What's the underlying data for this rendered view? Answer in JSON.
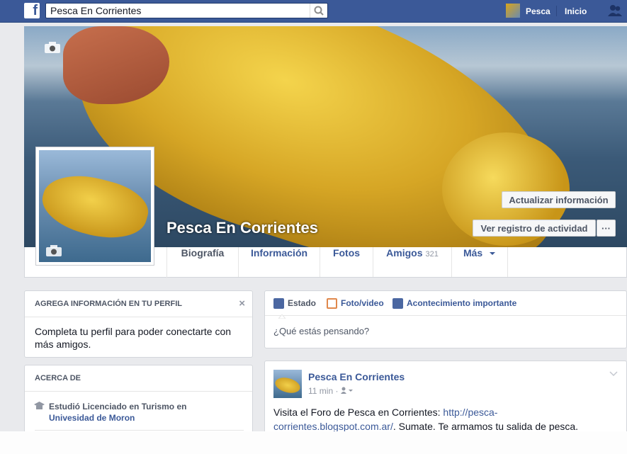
{
  "topbar": {
    "logo": "f",
    "search_value": "Pesca En Corrientes",
    "user_name": "Pesca",
    "home_label": "Inicio",
    "icons": [
      "facebook-logo-icon",
      "search-icon",
      "friend-requests-icon"
    ],
    "brand_color": "#3b5998"
  },
  "cover": {
    "page_name": "Pesca En Corrientes",
    "update_info_label": "Actualizar información",
    "activity_log_label": "Ver registro de actividad",
    "more_label": "···"
  },
  "tabs": [
    {
      "label": "Biografía"
    },
    {
      "label": "Información"
    },
    {
      "label": "Fotos"
    },
    {
      "label": "Amigos",
      "count": "321"
    },
    {
      "label": "Más"
    }
  ],
  "profile_prompt": {
    "title": "AGREGA INFORMACIÓN EN TU PERFIL",
    "close": "×",
    "text": "Completa tu perfil para poder conectarte con más amigos."
  },
  "about": {
    "title": "ACERCA DE",
    "education_prefix": "Estudió Licenciado en Turismo en",
    "education_place": "Univesidad de Moron"
  },
  "composer": {
    "tab_status": "Estado",
    "tab_photo": "Foto/video",
    "tab_event": "Acontecimiento importante",
    "placeholder": "¿Qué estás pensando?"
  },
  "post": {
    "author": "Pesca En Corrientes",
    "time": "11 min",
    "text_before": "Visita el Foro de Pesca en Corrientes: ",
    "link_part1": "http://pesca-",
    "link_part2": "corrientes.blogspot.com.ar/",
    "text_after": ". Sumate. Te armamos tu salida de pesca."
  }
}
